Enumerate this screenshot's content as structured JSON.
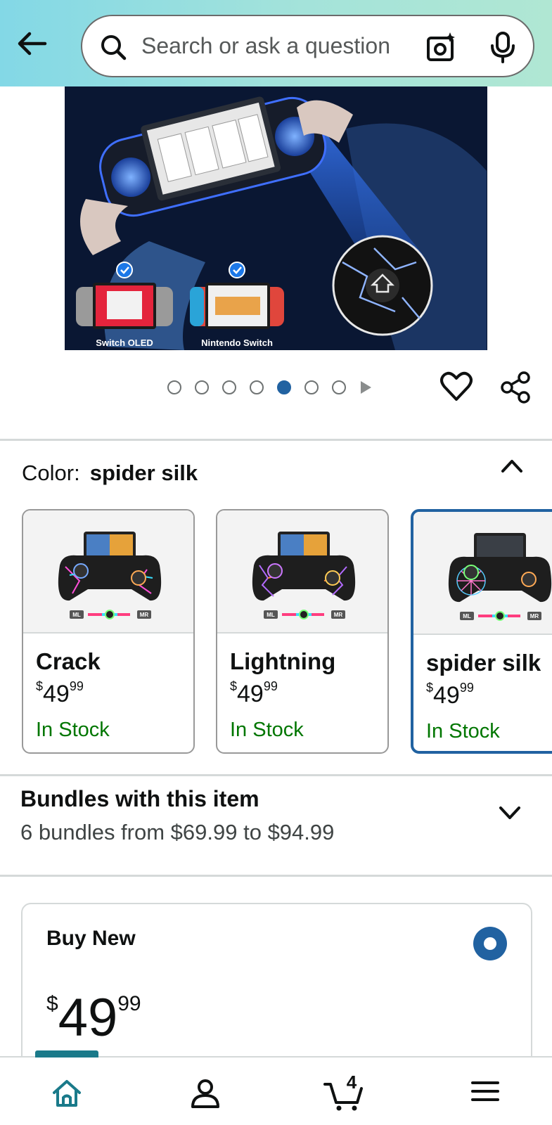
{
  "header": {
    "search": {
      "placeholder": "Search or ask a question"
    }
  },
  "product_image": {
    "labels": [
      "Switch OLED",
      "Nintendo Switch"
    ],
    "carousel": {
      "total_dots": 7,
      "active_index": 4
    }
  },
  "color": {
    "label": "Color:",
    "value": "spider silk",
    "options": [
      {
        "name": "Crack",
        "price_currency": "$",
        "price_whole": "49",
        "price_fraction": "99",
        "stock": "In Stock",
        "selected": false
      },
      {
        "name": "Lightning",
        "price_currency": "$",
        "price_whole": "49",
        "price_fraction": "99",
        "stock": "In Stock",
        "selected": false
      },
      {
        "name": "spider silk",
        "price_currency": "$",
        "price_whole": "49",
        "price_fraction": "99",
        "stock": "In Stock",
        "selected": true
      }
    ],
    "badge_labels": [
      "ML",
      "MR"
    ]
  },
  "bundles": {
    "title": "Bundles with this item",
    "subtitle": "6 bundles from $69.99 to $94.99"
  },
  "buy_new": {
    "title": "Buy New",
    "price_currency": "$",
    "price_whole": "49",
    "price_fraction": "99"
  },
  "bottom_nav": {
    "cart_count": "4",
    "items": [
      "home-icon",
      "account-icon",
      "cart-icon",
      "menu-icon"
    ]
  },
  "colors": {
    "accent": "#2162a1",
    "stock_green": "#007600",
    "header_gradient_start": "#83d8e6",
    "header_gradient_end": "#b0e7d3",
    "nav_active": "#1a7a8a"
  }
}
